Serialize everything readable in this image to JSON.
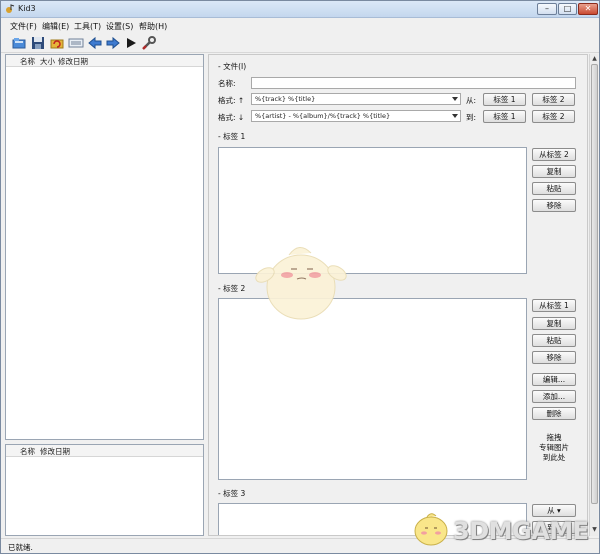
{
  "window": {
    "title": "Kid3",
    "min": "–",
    "max": "□",
    "close": "✕"
  },
  "menu": [
    "文件(F)",
    "编辑(E)",
    "工具(T)",
    "设置(S)",
    "帮助(H)"
  ],
  "toolbar_icons": [
    "open-folder-icon",
    "save-icon",
    "revert-icon",
    "playlist-icon",
    "previous-icon",
    "next-icon",
    "play-icon",
    "settings-icon"
  ],
  "file_pane": {
    "columns": [
      "名称",
      "大小",
      "修改日期"
    ]
  },
  "dir_pane": {
    "columns": [
      "名称",
      "修改日期"
    ]
  },
  "file_section": {
    "title": "- 文件(I)",
    "name_label": "名称:",
    "name_value": "",
    "format_up_label": "格式: ↑",
    "format_up_value": "%{track} %{title}",
    "from_label": "从:",
    "format_down_label": "格式: ↓",
    "format_down_value": "%{artist} - %{album}/%{track} %{title}",
    "to_label": "到:",
    "tag1_btn": "标签 1",
    "tag2_btn": "标签 2"
  },
  "tag1_section": {
    "title": "- 标签 1",
    "buttons": [
      "从标签 2",
      "复制",
      "粘贴",
      "移除"
    ]
  },
  "tag2_section": {
    "title": "- 标签 2",
    "buttons": [
      "从标签 1",
      "复制",
      "粘贴",
      "移除"
    ],
    "edit_buttons": [
      "编辑...",
      "添加...",
      "删除"
    ],
    "drop_hint_lines": [
      "拖拽",
      "专辑图片",
      "到此处"
    ]
  },
  "tag3_section": {
    "title": "- 标签 3",
    "buttons": [
      "从",
      "到"
    ]
  },
  "status": "已就绪.",
  "watermark": "3DMGAME"
}
